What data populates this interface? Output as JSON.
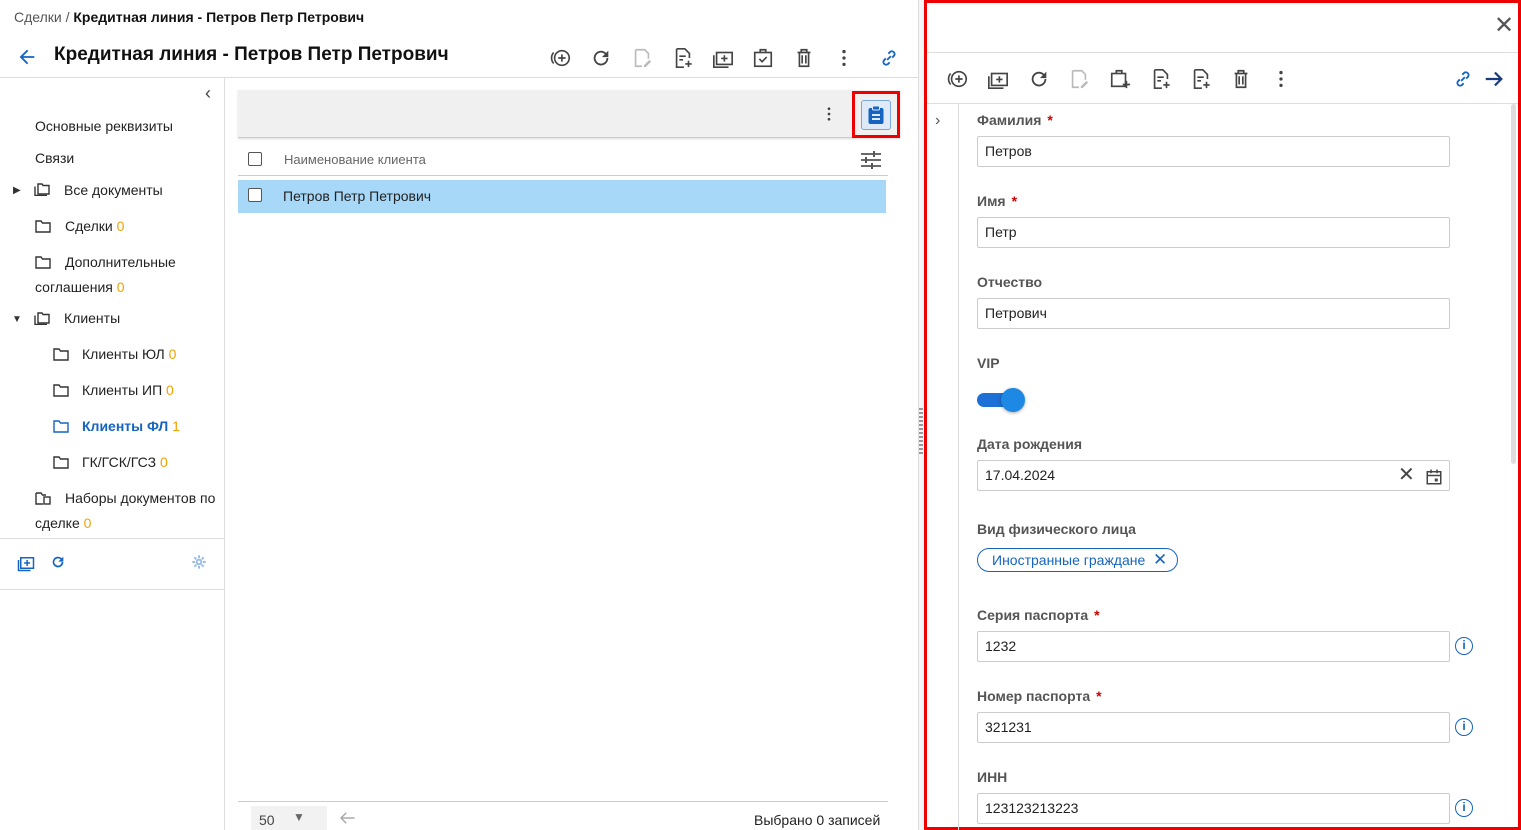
{
  "breadcrumb": {
    "root": "Сделки",
    "sep": "/",
    "current": "Кредитная линия - Петров Петр Петрович"
  },
  "page_title": "Кредитная линия - Петров Петр Петрович",
  "toolbar_icons": [
    "add-circle-icon",
    "refresh-icon",
    "edit-doc-icon",
    "add-doc-icon",
    "add-folder-icon",
    "check-case-icon",
    "trash-icon",
    "more-vert-icon",
    "link-icon"
  ],
  "sidebar": {
    "items": [
      {
        "label": "Основные реквизиты",
        "count": ""
      },
      {
        "label": "Связи",
        "count": ""
      },
      {
        "label": "Все документы",
        "count": ""
      },
      {
        "label": "Сделки",
        "count": "0"
      },
      {
        "label": "Дополнительные",
        "label2": "соглашения",
        "count": "0"
      },
      {
        "label": "Клиенты",
        "count": ""
      },
      {
        "label": "Клиенты ЮЛ",
        "count": "0"
      },
      {
        "label": "Клиенты ИП",
        "count": "0"
      },
      {
        "label": "Клиенты ФЛ",
        "count": "1"
      },
      {
        "label": "ГК/ГСК/ГСЗ",
        "count": "0"
      },
      {
        "label": "Наборы документов по",
        "label2": "сделке",
        "count": "0"
      }
    ]
  },
  "grid": {
    "column": "Наименование клиента",
    "rows": [
      {
        "name": "Петров Петр Петрович"
      }
    ],
    "page_size": "50",
    "selected_text": "Выбрано 0 записей"
  },
  "form": {
    "fields": {
      "last_name": {
        "label": "Фамилия",
        "value": "Петров",
        "required": "*"
      },
      "first_name": {
        "label": "Имя",
        "value": "Петр",
        "required": "*"
      },
      "patronymic": {
        "label": "Отчество",
        "value": "Петрович"
      },
      "vip": {
        "label": "VIP"
      },
      "birth_date": {
        "label": "Дата рождения",
        "value": "17.04.2024"
      },
      "person_type": {
        "label": "Вид физического лица",
        "chip": "Иностранные граждане"
      },
      "passport_series": {
        "label": "Серия паспорта",
        "value": "1232",
        "required": "*"
      },
      "passport_number": {
        "label": "Номер паспорта",
        "value": "321231",
        "required": "*"
      },
      "inn": {
        "label": "ИНН",
        "value": "123123213223"
      }
    }
  },
  "colors": {
    "accent": "#1565c0",
    "highlight": "#e00000",
    "row_selected": "#a7d8f8",
    "count": "#f2a100"
  }
}
